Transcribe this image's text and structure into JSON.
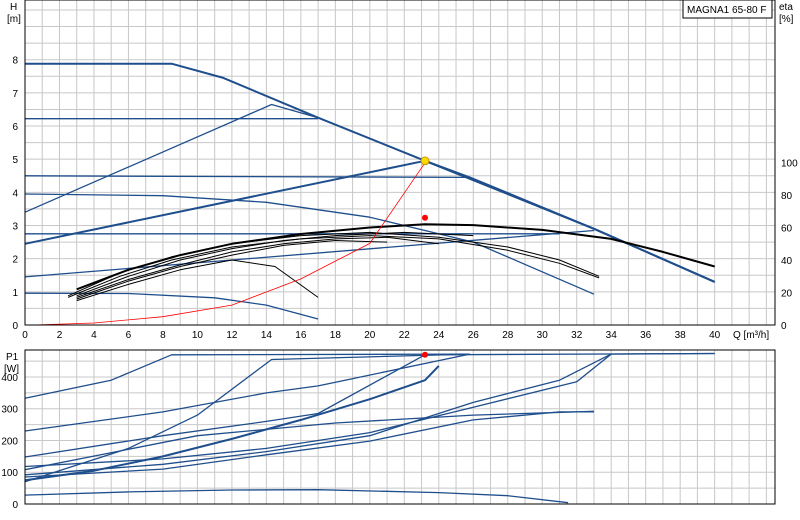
{
  "model_label": "MAGNA1 65-80 F",
  "chart_data": [
    {
      "type": "line",
      "panel": "head-efficiency",
      "y_axis_left": {
        "label": "H",
        "unit": "[m]",
        "ticks": [
          0,
          1,
          2,
          3,
          4,
          5,
          6,
          7,
          8
        ],
        "ylim": [
          0,
          9.8
        ]
      },
      "y_axis_right": {
        "label": "eta",
        "unit": "[%]",
        "ticks": [
          0,
          20,
          40,
          60,
          80,
          100
        ],
        "ylim": [
          0,
          100
        ]
      },
      "x_axis": {
        "label": "Q [m³/h]",
        "ticks": [
          0,
          2,
          4,
          6,
          8,
          10,
          12,
          14,
          16,
          18,
          20,
          22,
          24,
          26,
          28,
          30,
          32,
          34,
          36,
          38,
          40
        ],
        "xlim": [
          0,
          43.5
        ]
      },
      "grid": true,
      "colors": {
        "pump_curve": "#1f4e8c",
        "efficiency": "#000000",
        "system_curve": "#ff0000",
        "duty_marker": "#ffd700",
        "eta_marker": "#ff0000"
      },
      "series": [
        {
          "role": "constant-curve-max",
          "values": [
            [
              0,
              7.88
            ],
            [
              8.5,
              7.88
            ],
            [
              11.5,
              7.45
            ],
            [
              17.0,
              6.25
            ],
            [
              23.2,
              4.95
            ],
            [
              25.8,
              4.45
            ],
            [
              33.0,
              2.9
            ],
            [
              40.0,
              1.3
            ]
          ]
        },
        {
          "role": "proportional-max",
          "values": [
            [
              0,
              2.45
            ],
            [
              23.2,
              4.95
            ],
            [
              33.0,
              2.9
            ],
            [
              40.0,
              1.3
            ]
          ]
        },
        {
          "role": "proportional",
          "values": [
            [
              0,
              3.4
            ],
            [
              14.3,
              6.65
            ],
            [
              17.0,
              6.25
            ]
          ]
        },
        {
          "role": "constant-pressure",
          "values": [
            [
              0,
              6.22
            ],
            [
              17.0,
              6.22
            ]
          ]
        },
        {
          "role": "constant-pressure",
          "values": [
            [
              0,
              4.5
            ],
            [
              25.8,
              4.45
            ]
          ]
        },
        {
          "role": "constant-pressure",
          "values": [
            [
              0,
              2.75
            ],
            [
              31.0,
              2.75
            ]
          ]
        },
        {
          "role": "proportional",
          "values": [
            [
              0,
              1.45
            ],
            [
              33.0,
              2.85
            ]
          ]
        },
        {
          "role": "constant-curve",
          "values": [
            [
              0,
              3.95
            ],
            [
              8.0,
              3.9
            ],
            [
              14.0,
              3.7
            ],
            [
              20.0,
              3.25
            ],
            [
              26.0,
              2.5
            ],
            [
              33.0,
              0.93
            ]
          ]
        },
        {
          "role": "constant-curve",
          "values": [
            [
              0,
              0.96
            ],
            [
              6.0,
              0.95
            ],
            [
              11.0,
              0.82
            ],
            [
              14.0,
              0.6
            ],
            [
              17.0,
              0.18
            ]
          ]
        }
      ],
      "efficiency_series": [
        {
          "role": "eta-max",
          "values": [
            [
              3.0,
              22
            ],
            [
              6.0,
              34
            ],
            [
              9.0,
              43
            ],
            [
              12.0,
              50
            ],
            [
              16.0,
              56
            ],
            [
              20.0,
              60
            ],
            [
              23.2,
              62
            ],
            [
              26.0,
              61.5
            ],
            [
              30.0,
              58.5
            ],
            [
              34.0,
              53
            ],
            [
              37.0,
              45
            ],
            [
              40.0,
              36
            ]
          ]
        },
        {
          "role": "eta",
          "values": [
            [
              2.5,
              18
            ],
            [
              5.5,
              32
            ],
            [
              8.5,
              42
            ],
            [
              12.0,
              50
            ],
            [
              16.0,
              55
            ],
            [
              20.0,
              57
            ],
            [
              24.0,
              54
            ],
            [
              28.0,
              48
            ],
            [
              31.0,
              40
            ],
            [
              33.3,
              30
            ]
          ]
        },
        {
          "role": "eta",
          "values": [
            [
              2.5,
              17
            ],
            [
              5.5,
              30
            ],
            [
              8.5,
              40
            ],
            [
              12.0,
              48
            ],
            [
              16.0,
              53
            ],
            [
              20.0,
              55
            ],
            [
              24.0,
              53
            ],
            [
              28.0,
              46
            ],
            [
              31.0,
              38
            ],
            [
              33.3,
              29
            ]
          ]
        },
        {
          "role": "eta",
          "values": [
            [
              3.0,
              18
            ],
            [
              6.0,
              30
            ],
            [
              9.0,
              40
            ],
            [
              12.0,
              47
            ],
            [
              15.0,
              52
            ],
            [
              18.0,
              55
            ],
            [
              22.0,
              57
            ],
            [
              26.0,
              55
            ]
          ]
        },
        {
          "role": "eta",
          "values": [
            [
              3.0,
              17
            ],
            [
              6.0,
              28
            ],
            [
              9.0,
              37
            ],
            [
              12.0,
              45
            ],
            [
              15.0,
              50
            ],
            [
              18.0,
              53
            ],
            [
              21.0,
              54
            ],
            [
              24.0,
              50
            ]
          ]
        },
        {
          "role": "eta",
          "values": [
            [
              3.0,
              16
            ],
            [
              6.0,
              27
            ],
            [
              9.0,
              36
            ],
            [
              12.0,
              43
            ],
            [
              15.0,
              49
            ],
            [
              18.0,
              52
            ],
            [
              21.0,
              51
            ]
          ]
        },
        {
          "role": "eta",
          "values": [
            [
              3.0,
              15
            ],
            [
              6.0,
              25
            ],
            [
              9.0,
              34
            ],
            [
              12.0,
              40
            ],
            [
              14.5,
              36
            ],
            [
              17.0,
              17
            ]
          ]
        }
      ],
      "system_curve": {
        "role": "system",
        "values": [
          [
            0.5,
            0
          ],
          [
            4.0,
            0.06
          ],
          [
            8.0,
            0.25
          ],
          [
            12.0,
            0.6
          ],
          [
            16.0,
            1.39
          ],
          [
            20.0,
            2.46
          ],
          [
            23.2,
            4.89
          ]
        ]
      },
      "duty_point": {
        "q": 23.2,
        "h": 4.95
      },
      "efficiency_point": {
        "q": 23.2,
        "eta": 66
      }
    },
    {
      "type": "line",
      "panel": "power",
      "y_axis_left": {
        "label": "P1",
        "unit": "[W]",
        "ticks": [
          0,
          100,
          200,
          300,
          400
        ],
        "ylim": [
          0,
          485
        ]
      },
      "x_axis": {
        "ticks": [
          0,
          2,
          4,
          6,
          8,
          10,
          12,
          14,
          16,
          18,
          20,
          22,
          24,
          26,
          28,
          30,
          32,
          34,
          36,
          38,
          40
        ],
        "xlim": [
          0,
          43.5
        ]
      },
      "grid": true,
      "series": [
        {
          "role": "power-max",
          "values": [
            [
              0,
              75
            ],
            [
              4.0,
              105
            ],
            [
              8.0,
              150
            ],
            [
              12.0,
              205
            ],
            [
              16.0,
              265
            ],
            [
              20.0,
              330
            ],
            [
              23.2,
              390
            ],
            [
              24.0,
              435
            ]
          ]
        },
        {
          "role": "power",
          "values": [
            [
              0,
              333
            ],
            [
              5.0,
              390
            ],
            [
              8.5,
              470
            ],
            [
              25.8,
              472
            ]
          ]
        },
        {
          "role": "power",
          "values": [
            [
              0,
              230
            ],
            [
              8.0,
              290
            ],
            [
              14.0,
              350
            ],
            [
              17.0,
              372
            ],
            [
              25.8,
              472
            ]
          ]
        },
        {
          "role": "power",
          "values": [
            [
              0,
              148
            ],
            [
              8.0,
              215
            ],
            [
              14.0,
              260
            ],
            [
              17.0,
              285
            ],
            [
              23.2,
              470
            ],
            [
              40.0,
              474
            ]
          ]
        },
        {
          "role": "power",
          "values": [
            [
              0,
              70
            ],
            [
              6.0,
              175
            ],
            [
              10.0,
              280
            ],
            [
              14.3,
              455
            ],
            [
              25.8,
              472
            ]
          ]
        },
        {
          "role": "power",
          "values": [
            [
              0,
              118
            ],
            [
              8.0,
              142
            ],
            [
              14.0,
              175
            ],
            [
              20.0,
              225
            ],
            [
              26.0,
              305
            ],
            [
              32.0,
              385
            ],
            [
              34.0,
              472
            ],
            [
              40.0,
              474
            ]
          ]
        },
        {
          "role": "power",
          "values": [
            [
              0,
              92
            ],
            [
              8.0,
              125
            ],
            [
              14.0,
              165
            ],
            [
              20.0,
              215
            ],
            [
              26.0,
              320
            ],
            [
              31.0,
              390
            ],
            [
              34.0,
              472
            ]
          ]
        },
        {
          "role": "power",
          "values": [
            [
              0,
              85
            ],
            [
              8.0,
              110
            ],
            [
              14.0,
              155
            ],
            [
              20.0,
              198
            ],
            [
              26.0,
              265
            ],
            [
              31.0,
              290
            ],
            [
              33.0,
              290
            ]
          ]
        },
        {
          "role": "power",
          "values": [
            [
              0,
              108
            ],
            [
              10.0,
              215
            ],
            [
              18.0,
              255
            ],
            [
              26.0,
              280
            ],
            [
              33.0,
              292
            ]
          ]
        },
        {
          "role": "power",
          "values": [
            [
              0,
              28
            ],
            [
              6.0,
              38
            ],
            [
              12.0,
              44
            ],
            [
              17.0,
              45
            ],
            [
              24.0,
              36
            ],
            [
              28.0,
              26
            ],
            [
              31.5,
              4
            ]
          ]
        }
      ],
      "operating_point": {
        "q": 23.2,
        "p1": 470
      }
    }
  ]
}
